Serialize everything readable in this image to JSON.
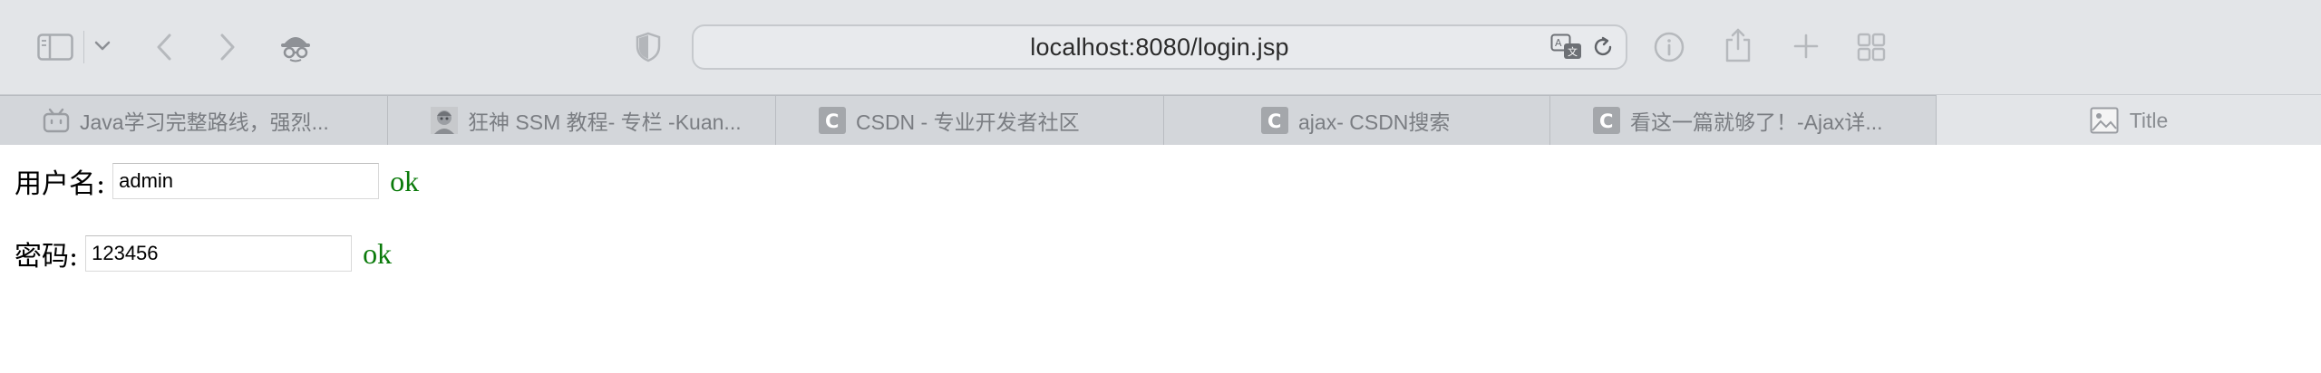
{
  "toolbar": {
    "url": "localhost:8080/login.jsp",
    "icons": [
      "sidebar-toggle-icon",
      "chevron-down-icon",
      "back-arrow-icon",
      "forward-arrow-icon",
      "privacy-mask-icon",
      "shield-icon",
      "translate-icon",
      "reload-icon",
      "info-icon",
      "share-icon",
      "new-tab-plus-icon",
      "tab-overview-icon"
    ]
  },
  "tabs": [
    {
      "title": "Java学习完整路线，强烈...",
      "favicon": "bilibili-icon"
    },
    {
      "title": "狂神 SSM 教程- 专栏 -Kuan...",
      "favicon": "avatar-icon"
    },
    {
      "title": "CSDN - 专业开发者社区",
      "favicon": "csdn-icon"
    },
    {
      "title": "ajax- CSDN搜索",
      "favicon": "csdn-icon"
    },
    {
      "title": "看这一篇就够了！-Ajax详...",
      "favicon": "csdn-icon"
    },
    {
      "title": "Title",
      "favicon": "image-icon",
      "active": true
    }
  ],
  "form": {
    "username_label": "用户名:",
    "username_value": "admin",
    "username_status": "ok",
    "password_label": "密码:",
    "password_value": "123456",
    "password_status": "ok"
  },
  "colors": {
    "toolbar_bg": "#e3e5e8",
    "tab_bg": "#d3d6da",
    "status_ok": "#0a7a0a"
  }
}
